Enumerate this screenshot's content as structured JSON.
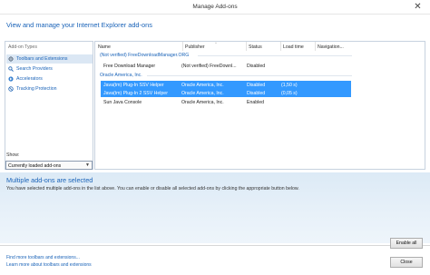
{
  "window": {
    "title": "Manage Add-ons",
    "close_glyph": "✕"
  },
  "header": {
    "heading": "View and manage your Internet Explorer add-ons"
  },
  "sidebar": {
    "heading": "Add-on Types",
    "items": [
      {
        "label": "Toolbars and Extensions",
        "icon": "gear-icon"
      },
      {
        "label": "Search Providers",
        "icon": "search-icon"
      },
      {
        "label": "Accelerators",
        "icon": "accelerator-icon"
      },
      {
        "label": "Tracking Protection",
        "icon": "no-entry-icon"
      }
    ],
    "show_label": "Show:",
    "show_value": "Currently loaded add-ons"
  },
  "list": {
    "columns": [
      "Name",
      "Publisher",
      "Status",
      "Load time",
      "Navigation..."
    ],
    "groups": [
      {
        "title": "(Not verified) FreeDownloadManager.ORG",
        "rows": [
          {
            "name": "Free Download Manager",
            "publisher": "(Not verified) FreeDownl...",
            "status": "Disabled",
            "load_time": "",
            "selected": false
          }
        ]
      },
      {
        "title": "Oracle America, Inc.",
        "rows": [
          {
            "name": "Java(tm) Plug-In SSV Helper",
            "publisher": "Oracle America, Inc.",
            "status": "Disabled",
            "load_time": "(1,50 s)",
            "selected": true
          },
          {
            "name": "Java(tm) Plug-In 2 SSV Helper",
            "publisher": "Oracle America, Inc.",
            "status": "Disabled",
            "load_time": "(0,05 s)",
            "selected": true
          },
          {
            "name": "Sun Java Console",
            "publisher": "Oracle America, Inc.",
            "status": "Enabled",
            "load_time": "",
            "selected": false
          }
        ]
      }
    ]
  },
  "details": {
    "title": "Multiple add-ons are selected",
    "text": "You have selected multiple add-ons in the list above. You can enable or disable all selected add-ons by clicking the appropriate button below."
  },
  "buttons": {
    "enable_all": "Enable all",
    "close": "Close"
  },
  "footer": {
    "link1": "Find more toolbars and extensions...",
    "link2": "Learn more about toolbars and extensions"
  },
  "colors": {
    "accent": "#1a63b8",
    "selection": "#3399ff",
    "details_bg": "#dceaf6"
  }
}
